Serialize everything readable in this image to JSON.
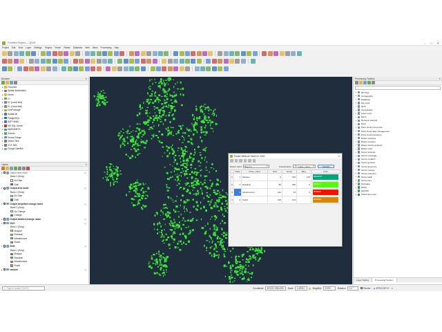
{
  "window": {
    "title": "*Untitled Project — QGIS",
    "controls": [
      "–",
      "□",
      "✕"
    ]
  },
  "menu": [
    "Project",
    "Edit",
    "View",
    "Layer",
    "Settings",
    "Plugins",
    "Vector",
    "Raster",
    "Database",
    "Web",
    "Mesh",
    "Processing",
    "Help"
  ],
  "browser": {
    "title": "Browser",
    "items": [
      {
        "label": "Favorites",
        "icon": "star-icon",
        "color": "#e8b923"
      },
      {
        "label": "Spatial Bookmarks",
        "icon": "bookmark-icon",
        "color": "#7a7a7a"
      },
      {
        "label": "Home",
        "icon": "folder-icon",
        "color": "#e0b84a"
      },
      {
        "label": "C:\\",
        "icon": "drive-icon",
        "color": "#8a8a8a"
      },
      {
        "label": "D:\\ (Local disk)",
        "icon": "drive-icon",
        "color": "#8a8a8a"
      },
      {
        "label": "E:\\ (Local disk)",
        "icon": "drive-icon",
        "color": "#8a8a8a"
      },
      {
        "label": "GeoPackage",
        "icon": "geopackage-icon",
        "color": "#c9a13b"
      },
      {
        "label": "SpatiaLite",
        "icon": "spatialite-icon",
        "color": "#4a7bb5"
      },
      {
        "label": "PostgreSQL",
        "icon": "postgresql-icon",
        "color": "#336791"
      },
      {
        "label": "SAP HANA",
        "icon": "database-icon",
        "color": "#3c7ad6"
      },
      {
        "label": "MS SQL Server",
        "icon": "database-icon",
        "color": "#b33b3b"
      },
      {
        "label": "WMS/WMTS",
        "icon": "globe-icon",
        "color": "#4a90c2"
      },
      {
        "label": "Scenes",
        "icon": "scene-icon",
        "color": "#6aa84f"
      },
      {
        "label": "SensorThings",
        "icon": "sensor-icon",
        "color": "#5b8dd6"
      },
      {
        "label": "Vector Tiles",
        "icon": "grid-icon",
        "color": "#7b7b7b"
      },
      {
        "label": "XYZ Tiles",
        "icon": "xyz-icon",
        "color": "#7b7b7b"
      },
      {
        "label": "Google Satellite",
        "icon": "layer-icon",
        "color": "#7b9fc9"
      }
    ]
  },
  "layers": {
    "title": "Layers",
    "items": [
      {
        "kind": "layer",
        "label": "Output area raster",
        "checked": true,
        "style": "italic",
        "expanded": true
      },
      {
        "kind": "band",
        "label": "Band 1 (Gray)"
      },
      {
        "kind": "class",
        "label": "No Data",
        "color": "#ffffff"
      },
      {
        "kind": "class",
        "label": "Gain",
        "color": "#d7191c"
      },
      {
        "kind": "layer",
        "label": "Output area raster",
        "checked": true,
        "style": "bold",
        "expanded": true
      },
      {
        "kind": "band",
        "label": "Band 1 (Gray)"
      },
      {
        "kind": "class",
        "label": "No Gain",
        "color": "#ffffff"
      },
      {
        "kind": "class",
        "label": "Gain",
        "color": "#1a9641"
      },
      {
        "kind": "layer",
        "label": "Output simplified change raster",
        "checked": true,
        "style": "bold",
        "expanded": true
      },
      {
        "kind": "band",
        "label": "Band 1 (Gray)"
      },
      {
        "kind": "class",
        "label": "No Change",
        "color": "#ffffff"
      },
      {
        "kind": "class",
        "label": "Change",
        "color": "#d01c8b"
      },
      {
        "kind": "layer",
        "label": "Output detailed change raster",
        "checked": true,
        "style": "bold",
        "expanded": false
      },
      {
        "kind": "layer",
        "label": "2021",
        "checked": true,
        "style": "bold",
        "expanded": true
      },
      {
        "kind": "band",
        "label": "Band 1 (Gray)"
      },
      {
        "kind": "class",
        "label": "Mosque",
        "color": "#f2eb4e"
      },
      {
        "kind": "class",
        "label": "Residual",
        "color": "#e8c84a"
      },
      {
        "kind": "class",
        "label": "Infrastructure",
        "color": "#8fce5b"
      },
      {
        "kind": "class",
        "label": "Sustic",
        "color": "#e0913a"
      },
      {
        "kind": "layer",
        "label": "2000",
        "checked": true,
        "style": "bold",
        "expanded": true
      },
      {
        "kind": "band",
        "label": "Band 1 (Gray)"
      },
      {
        "kind": "class",
        "label": "Mosque",
        "color": "#2e8b57"
      },
      {
        "kind": "class",
        "label": "Residual",
        "color": "#47c447"
      },
      {
        "kind": "class",
        "label": "Infrastructure",
        "color": "#e05a5a"
      },
      {
        "kind": "class",
        "label": "Sustic",
        "color": "#e08a2a"
      },
      {
        "kind": "layer",
        "label": "random",
        "checked": true,
        "style": "bold",
        "expanded": false
      }
    ]
  },
  "dialog": {
    "title": "Raster Attribute Table for 2000",
    "raster_band_label": "Raster band",
    "raster_band_value": "Band 1",
    "classification_label": "Classification",
    "classification_value": "Class_name",
    "classify_button": "Classify",
    "columns": [
      "Value",
      "Class_name",
      "Red",
      "Green",
      "Blue",
      "Color"
    ],
    "rows": [
      {
        "index": "1",
        "value": "1",
        "class_name": "Mosque",
        "red": "0",
        "green": "166",
        "blue": "120",
        "color_label": "#00A6078",
        "color": "#00a678"
      },
      {
        "index": "2",
        "value": "2",
        "class_name": "Residual",
        "red": "80",
        "green": "255",
        "blue": "0",
        "color_label": "#50FF00",
        "color": "#50ff00"
      },
      {
        "index": "3",
        "value": "3",
        "class_name": "Infrastructure",
        "red": "251",
        "green": "14",
        "blue": "0",
        "color_label": "#FB0E00",
        "color": "#fb0e00"
      },
      {
        "index": "4",
        "value": "4",
        "class_name": "Sustic",
        "red": "220",
        "green": "132",
        "blue": "",
        "color_label": "#DC8400",
        "color": "#dc8400"
      }
    ]
  },
  "processing": {
    "title": "Processing Toolbox",
    "items": [
      {
        "label": "3D Tiles",
        "color": "#7d8fa8"
      },
      {
        "label": "Cartography",
        "color": "#7d8fa8"
      },
      {
        "label": "Database",
        "color": "#7d8fa8"
      },
      {
        "label": "File tools",
        "color": "#7d8fa8"
      },
      {
        "label": "GPS",
        "color": "#7d8fa8"
      },
      {
        "label": "Interpolation",
        "color": "#7d8fa8"
      },
      {
        "label": "Layer tools",
        "color": "#7d8fa8"
      },
      {
        "label": "Mesh",
        "color": "#7d8fa8"
      },
      {
        "label": "Network analysis",
        "color": "#7d8fa8"
      },
      {
        "label": "Plots",
        "color": "#7d8fa8"
      },
      {
        "label": "Point cloud conversion",
        "color": "#7d8fa8"
      },
      {
        "label": "Point cloud data management",
        "color": "#7d8fa8"
      },
      {
        "label": "Point cloud extraction",
        "color": "#7d8fa8"
      },
      {
        "label": "Raster analysis",
        "color": "#7d8fa8"
      },
      {
        "label": "Raster creation",
        "color": "#7d8fa8"
      },
      {
        "label": "Raster terrain analysis",
        "color": "#7d8fa8"
      },
      {
        "label": "Raster tools",
        "color": "#7d8fa8"
      },
      {
        "label": "Vector analysis",
        "color": "#7d8fa8"
      },
      {
        "label": "Vector coverage",
        "color": "#7d8fa8"
      },
      {
        "label": "Vector creation",
        "color": "#7d8fa8"
      },
      {
        "label": "Vector general",
        "color": "#7d8fa8"
      },
      {
        "label": "Vector geometry",
        "color": "#7d8fa8"
      },
      {
        "label": "Vector overlay",
        "color": "#7d8fa8"
      },
      {
        "label": "Vector selection",
        "color": "#7d8fa8"
      },
      {
        "label": "Vector table",
        "color": "#7d8fa8"
      },
      {
        "label": "Vector tiles",
        "color": "#7d8fa8"
      },
      {
        "label": "Dzetsaka",
        "color": "#5aa05a"
      },
      {
        "label": "GDAL",
        "color": "#3b7bbf"
      },
      {
        "label": "GRASS",
        "color": "#4c9b4c"
      },
      {
        "label": "SAGA Next Gen",
        "color": "#2f6ab3"
      }
    ],
    "tabs": [
      "Layer Styling",
      "Processing Toolbox"
    ]
  },
  "status": {
    "locator_placeholder": "Type to locate (Ctrl+K)",
    "coordinate_label": "Coordinate",
    "coordinate_value": "491221  5961490",
    "scale_label": "Scale",
    "scale_value": "1:49912",
    "magnifier_label": "Magnifier",
    "magnifier_value": "100%",
    "rotation_label": "Rotation",
    "rotation_value": "0.0 °",
    "render_label": "Render",
    "crs_label": "EPSG:32717"
  },
  "colors": {
    "map_bg": "#1f2d3d",
    "map_feature": "#3be33b",
    "classify_button": "#dbe9f7"
  }
}
